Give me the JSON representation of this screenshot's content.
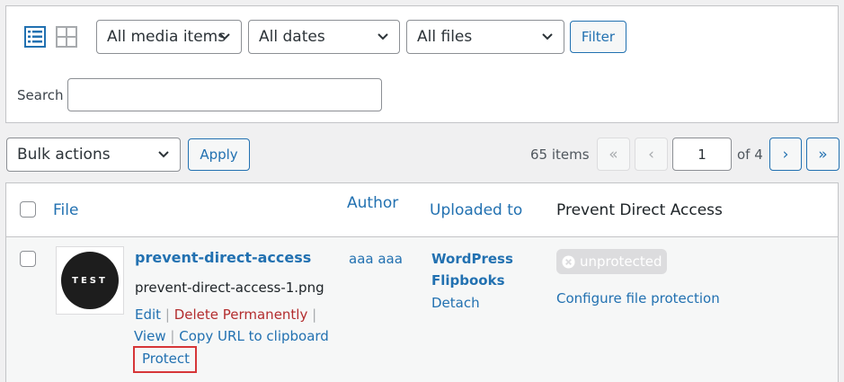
{
  "toolbar": {
    "view_list_icon": "list-view-icon",
    "view_grid_icon": "grid-view-icon",
    "media_type_filter": "All media items",
    "date_filter": "All dates",
    "files_filter": "All files",
    "filter_button": "Filter",
    "search_label": "Search",
    "search_value": ""
  },
  "bulk": {
    "bulk_actions": "Bulk actions",
    "apply_button": "Apply",
    "items_count": "65 items",
    "first_page": "«",
    "prev_page": "‹",
    "current_page": "1",
    "of_pages": "of 4",
    "next_page": "›",
    "last_page": "»"
  },
  "table": {
    "columns": {
      "file": "File",
      "author": "Author",
      "uploaded_to": "Uploaded to",
      "pda": "Prevent Direct Access"
    },
    "row": {
      "thumbnail_text": "TEST",
      "title": "prevent-direct-access",
      "filename": "prevent-direct-access-1.png",
      "actions": {
        "edit": "Edit",
        "delete": "Delete Permanently",
        "view": "View",
        "copy_url": "Copy URL to clipboard",
        "protect": "Protect",
        "sep": "|"
      },
      "author": "aaa aaa",
      "uploaded_to_line1": "WordPress",
      "uploaded_to_line2": "Flipbooks",
      "detach": "Detach",
      "status_badge": "unprotected",
      "configure_link": "Configure file protection"
    }
  },
  "colors": {
    "link": "#2271b1",
    "delete": "#b32d2e",
    "highlight_box": "#d63638",
    "badge_bg": "#dcdcde"
  }
}
